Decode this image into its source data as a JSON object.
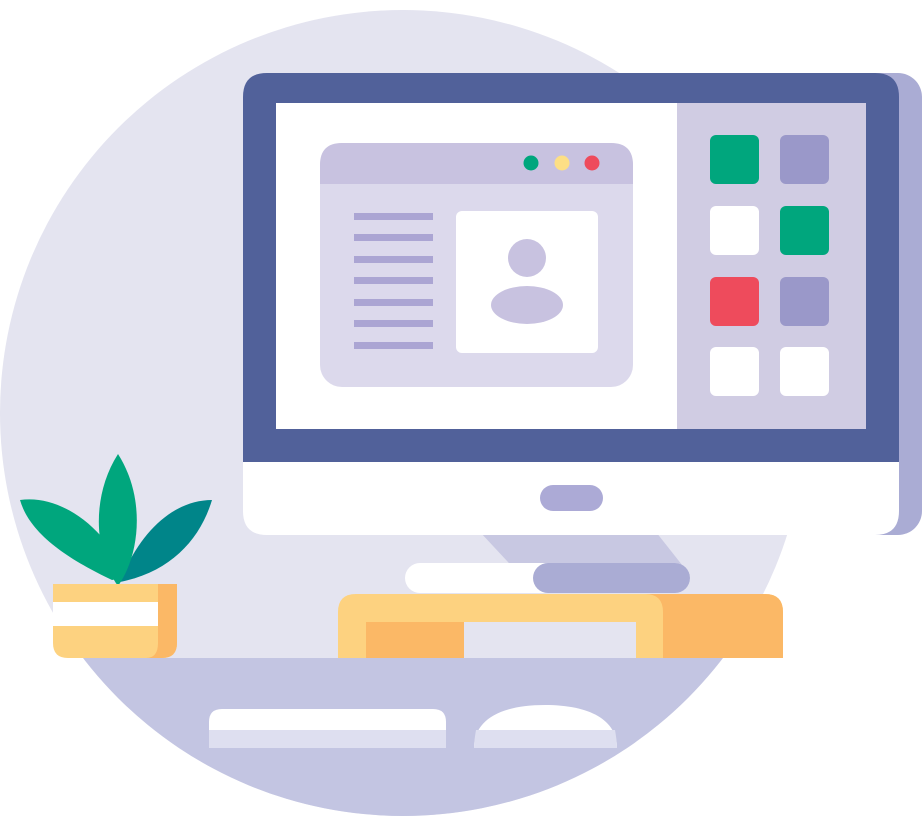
{
  "illustration": {
    "subject": "desktop-computer-workspace",
    "colors": {
      "background_circle": "#E4E4F0",
      "desk": "#C3C5E2",
      "monitor_frame": "#51619A",
      "monitor_bezel_shadow": "#AAACD4",
      "monitor_chin": "#FFFFFF",
      "monitor_button": "#ACAAD6",
      "screen": "#FFFFFF",
      "sidebar": "#D0CCE3",
      "window_body": "#DCD9EC",
      "window_titlebar": "#C8C2E0",
      "text_lines": "#ABA5D3",
      "avatar": "#C8C2E0",
      "green": "#00A67D",
      "yellow": "#FDDF85",
      "red": "#EE4B5C",
      "purple_tile": "#9A98C9",
      "stand": "#C8C8E2",
      "shelf_light": "#FDD280",
      "shelf_dark": "#FBB866",
      "leaf_green": "#00A67D",
      "leaf_teal": "#008589",
      "pot": "#FDD280",
      "keyboard": "#FFFFFF",
      "keyboard_shadow": "#DEDFF0"
    },
    "window_controls": [
      "green",
      "yellow",
      "red"
    ],
    "tile_grid": [
      [
        "green",
        "purple"
      ],
      [
        "white",
        "green"
      ],
      [
        "red",
        "purple"
      ],
      [
        "white",
        "white"
      ]
    ],
    "text_line_count": 7
  }
}
